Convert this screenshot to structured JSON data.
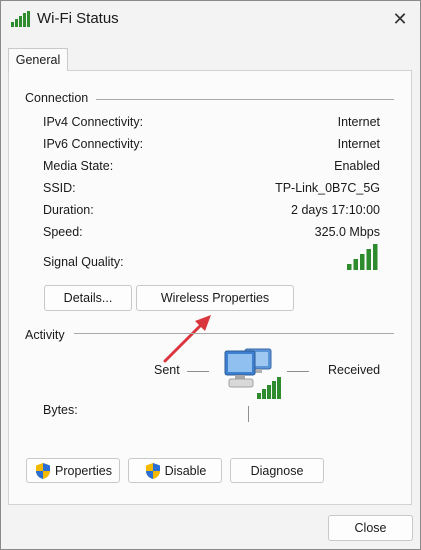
{
  "window": {
    "title": "Wi-Fi Status",
    "close_glyph": "✕"
  },
  "tabs": [
    {
      "label": "General"
    }
  ],
  "connection": {
    "section_label": "Connection",
    "rows": [
      {
        "label": "IPv4 Connectivity:",
        "value": "Internet"
      },
      {
        "label": "IPv6 Connectivity:",
        "value": "Internet"
      },
      {
        "label": "Media State:",
        "value": "Enabled"
      },
      {
        "label": "SSID:",
        "value": "TP-Link_0B7C_5G"
      },
      {
        "label": "Duration:",
        "value": "2 days 17:10:00"
      },
      {
        "label": "Speed:",
        "value": "325.0 Mbps"
      }
    ],
    "signal_label": "Signal Quality:",
    "signal_bars_filled": 5,
    "signal_bars_total": 5,
    "details_button": "Details...",
    "wireless_properties_button": "Wireless Properties"
  },
  "activity": {
    "section_label": "Activity",
    "sent_label": "Sent",
    "received_label": "Received",
    "bytes_label": "Bytes:",
    "properties_button": "Properties",
    "disable_button": "Disable",
    "diagnose_button": "Diagnose"
  },
  "footer": {
    "close_button": "Close"
  },
  "colors": {
    "signal_green": "#2e8b2e",
    "arrow_red": "#d9363e",
    "accent": "#0067c0"
  }
}
